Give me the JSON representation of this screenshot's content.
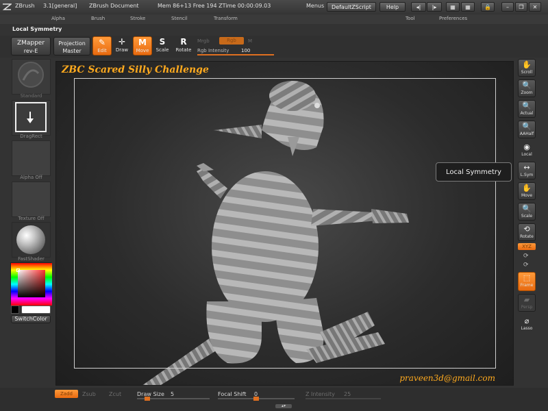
{
  "titlebar": {
    "app": "ZBrush",
    "version": "3.1[general]",
    "document": "ZBrush Document",
    "mem": "Mem 86+13 Free 194 ZTime 00:00:09.03",
    "menus_label": "Menus",
    "zscript_button": "DefaultZScript",
    "help_button": "Help"
  },
  "menubar": {
    "items": [
      "Alpha",
      "Brush",
      "Stroke",
      "Stencil",
      "Transform",
      "Tool",
      "Preferences"
    ]
  },
  "palette_title": "Local Symmetry",
  "topshelf": {
    "zmapper": "ZMapper",
    "zmapper_sub": "rev-E",
    "projection": "Projection",
    "projection_sub": "Master",
    "tools": [
      {
        "label": "Edit",
        "glyph": "✎",
        "icon": "edit-icon"
      },
      {
        "label": "Draw",
        "glyph": "✛",
        "icon": "draw-icon"
      },
      {
        "label": "Move",
        "glyph": "M",
        "icon": "move-icon"
      },
      {
        "label": "Scale",
        "glyph": "S",
        "icon": "scale-icon"
      },
      {
        "label": "Rotate",
        "glyph": "R",
        "icon": "rotate-icon"
      }
    ],
    "mrgb": "Mrgb",
    "rgb": "Rgb",
    "m": "M",
    "rgb_intensity_label": "Rgb Intensity",
    "rgb_intensity_value": "100",
    "rgb_intensity_fraction": 1.0
  },
  "lefttray": {
    "brush_label": "Standard",
    "stroke_label": "DragRect",
    "alpha_label": "Alpha Off",
    "texture_label": "Texture Off",
    "material_label": "FastShader",
    "switch_color": "SwitchColor"
  },
  "canvas": {
    "title": "ZBC Scared Silly Challenge",
    "email": "praveen3d@gmail.com"
  },
  "tooltip": "Local Symmetry",
  "righttray": {
    "buttons": [
      {
        "label": "Scroll",
        "glyph": "✋",
        "icon": "scroll-hand-icon"
      },
      {
        "label": "Zoom",
        "glyph": "🔍",
        "icon": "zoom-icon"
      },
      {
        "label": "Actual",
        "glyph": "🔍",
        "icon": "actual-size-icon"
      },
      {
        "label": "AAHalf",
        "glyph": "🔍",
        "icon": "aahalf-icon"
      },
      {
        "label": "Local",
        "glyph": "◉",
        "icon": "local-icon"
      },
      {
        "label": "L.Sym",
        "glyph": "↔",
        "icon": "local-symmetry-icon"
      },
      {
        "label": "Move",
        "glyph": "✋",
        "icon": "move-view-icon"
      },
      {
        "label": "Scale",
        "glyph": "🔍",
        "icon": "scale-view-icon"
      },
      {
        "label": "Rotate",
        "glyph": "⟲",
        "icon": "rotate-view-icon"
      }
    ],
    "xyz": "XYZ",
    "frame": "Frame",
    "persp": "Persp",
    "lasso": "Lasso"
  },
  "bottomshelf": {
    "zadd": "Zadd",
    "zsub": "Zsub",
    "zcut": "Zcut",
    "draw_size_label": "Draw Size",
    "draw_size_value": "5",
    "focal_shift_label": "Focal Shift",
    "focal_shift_value": "0",
    "z_intensity_label": "Z Intensity",
    "z_intensity_value": "25"
  },
  "colors": {
    "accent": "#f07a1a",
    "title_text": "#ffaa1e",
    "panel": "#333333"
  }
}
